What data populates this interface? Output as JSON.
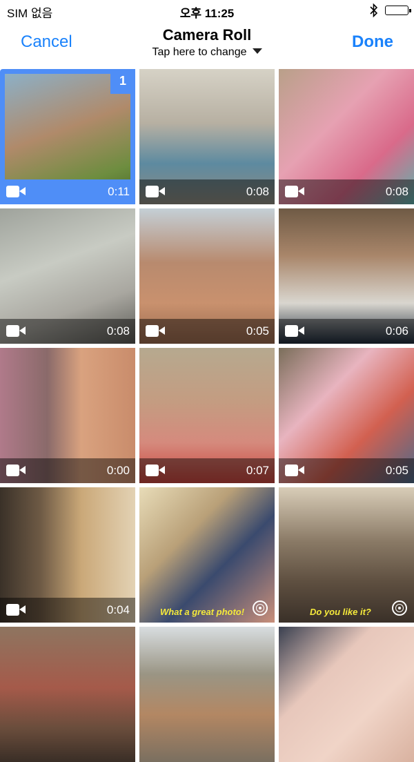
{
  "status_bar": {
    "carrier": "SIM 없음",
    "time": "오후 11:25"
  },
  "nav": {
    "cancel_label": "Cancel",
    "title": "Camera Roll",
    "subtitle": "Tap here to change",
    "done_label": "Done"
  },
  "colors": {
    "accent": "#1a82fb",
    "selection": "#4f8ef7"
  },
  "grid": {
    "items": [
      {
        "kind": "video",
        "duration": "0:11",
        "selected": true,
        "badge": "1",
        "subject": "elderly man profile"
      },
      {
        "kind": "video",
        "duration": "0:08",
        "subject": "diving tower"
      },
      {
        "kind": "video",
        "duration": "0:08",
        "subject": "woman lounging in pink"
      },
      {
        "kind": "video",
        "duration": "0:08",
        "subject": "laptop screen"
      },
      {
        "kind": "video",
        "duration": "0:05",
        "subject": "man in sunglasses sunbathing"
      },
      {
        "kind": "video",
        "duration": "0:06",
        "subject": "old man with white beard"
      },
      {
        "kind": "video",
        "duration": "0:00",
        "subject": "smiling boy"
      },
      {
        "kind": "video",
        "duration": "0:07",
        "subject": "blurred woman"
      },
      {
        "kind": "video",
        "duration": "0:05",
        "subject": "girl taking photo with phone"
      },
      {
        "kind": "video",
        "duration": "0:04",
        "subject": "man by window"
      },
      {
        "kind": "live",
        "caption": "What a great photo!",
        "subject": "old woman in headscarf"
      },
      {
        "kind": "live",
        "caption": "Do you like it?",
        "subject": "cafe scene"
      },
      {
        "kind": "photo",
        "subject": "cafe interior"
      },
      {
        "kind": "photo",
        "subject": "village street"
      },
      {
        "kind": "photo",
        "subject": "woman close-up"
      }
    ]
  }
}
